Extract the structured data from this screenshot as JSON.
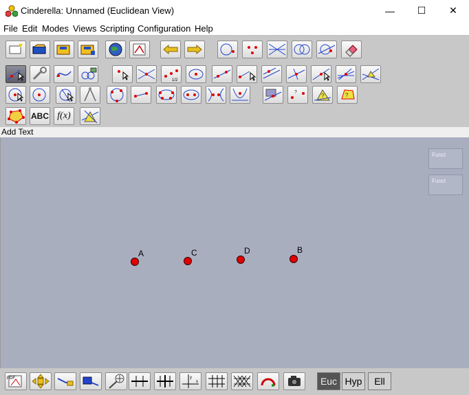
{
  "window": {
    "title": "Cinderella: Unnamed (Euclidean View)",
    "controls": [
      "—",
      "☐",
      "✕"
    ]
  },
  "menu": [
    "File",
    "Edit",
    "Modes",
    "Views",
    "Scripting",
    "Configuration",
    "Help"
  ],
  "toolbar": {
    "abc_label": "ABC",
    "fx_label": "f(x)",
    "half_label": "1/2",
    "q_label": "?"
  },
  "status": {
    "text": "Add Text"
  },
  "canvas": {
    "funct_buttons": [
      "Funct",
      "Funct"
    ],
    "points": [
      {
        "label": "A"
      },
      {
        "label": "C"
      },
      {
        "label": "D"
      },
      {
        "label": "B"
      }
    ],
    "point_color": "#e00000",
    "background": "#a9aebf"
  },
  "bottombar": {
    "pdf_label": "PDF",
    "geometries": [
      "Euc",
      "Hyp",
      "Ell"
    ],
    "selected_geometry": "Euc"
  }
}
